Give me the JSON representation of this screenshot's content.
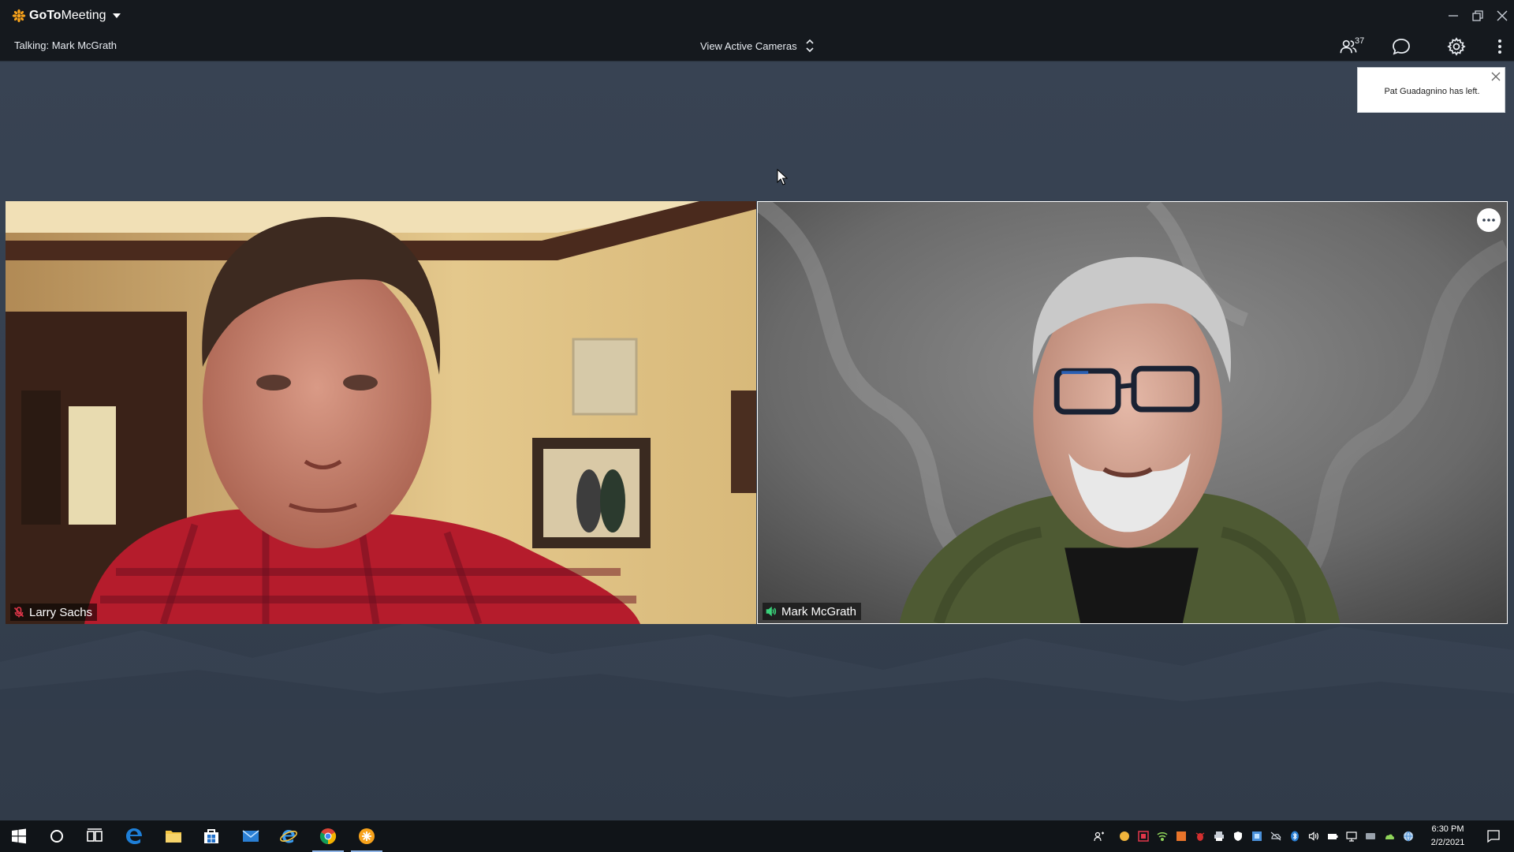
{
  "app": {
    "name_bold": "GoTo",
    "name_light": "Meeting",
    "icon": "goto-burst-logo"
  },
  "window_controls": [
    "minimize-icon",
    "restore-icon",
    "close-icon"
  ],
  "toolbar": {
    "talking_label": "Talking: Mark McGrath",
    "view_label": "View Active Cameras",
    "attendee_count": "37",
    "icons": [
      "attendees-icon",
      "chat-icon",
      "settings-gear-icon",
      "more-vertical-icon"
    ]
  },
  "notification": {
    "text": "Pat Guadagnino has left."
  },
  "tiles": [
    {
      "name": "Larry Sachs",
      "mic_status": "muted",
      "icon": "mic-muted-icon"
    },
    {
      "name": "Mark McGrath",
      "mic_status": "speaking",
      "icon": "speaker-active-icon"
    }
  ],
  "taskbar": {
    "apps": [
      "start",
      "search",
      "task-view",
      "edge",
      "file-explorer",
      "store",
      "mail",
      "internet-explorer",
      "chrome",
      "gotomeeting"
    ],
    "active_apps": [
      "chrome",
      "gotomeeting"
    ],
    "clock_time": "6:30 PM",
    "clock_date": "2/2/2021"
  },
  "colors": {
    "stage": "#35404f",
    "titlebar": "#15191e",
    "accent": "#f7a21b",
    "speaking": "#3ad27a",
    "muted": "#e2364a"
  }
}
